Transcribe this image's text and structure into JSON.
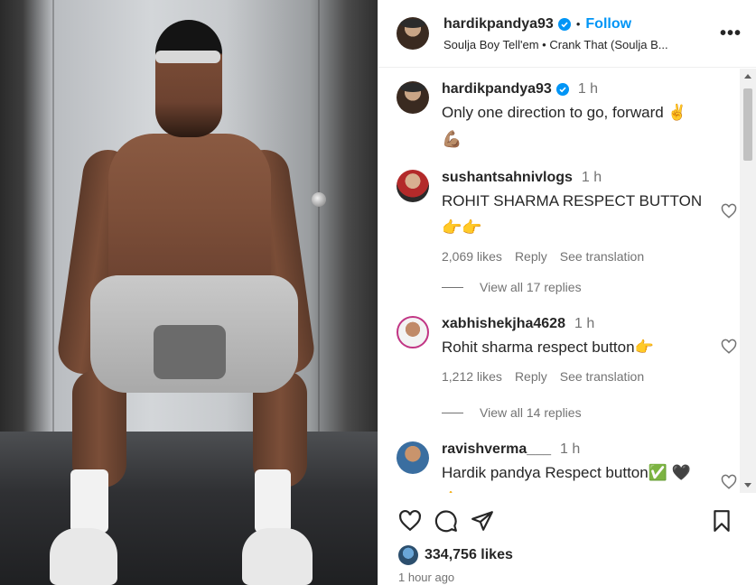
{
  "header": {
    "username": "hardikpandya93",
    "separator": "•",
    "follow_label": "Follow",
    "audio": "Soulja Boy Tell'em • Crank That (Soulja B...",
    "more_label": "•••"
  },
  "caption": {
    "username": "hardikpandya93",
    "time": "1 h",
    "text": "Only one direction to go, forward ✌️",
    "emoji_line": "💪🏽"
  },
  "comments": [
    {
      "username": "sushantsahnivlogs",
      "time": "1 h",
      "text": "ROHIT SHARMA RESPECT BUTTON",
      "emoji_line": "👉👉",
      "likes": "2,069 likes",
      "reply": "Reply",
      "translation": "See translation",
      "view_replies": "View all 17 replies"
    },
    {
      "username": "xabhishekjha4628",
      "time": "1 h",
      "text": "Rohit sharma respect button👉",
      "likes": "1,212 likes",
      "reply": "Reply",
      "translation": "See translation",
      "view_replies": "View all 14 replies"
    },
    {
      "username": "ravishverma___",
      "time": "1 h",
      "text": "Hardik pandya Respect button✅ 🖤",
      "emoji_line": "👉"
    }
  ],
  "footer": {
    "likes": "334,756 likes",
    "posted": "1 hour ago"
  },
  "icons": {
    "like": "heart-icon",
    "comment": "comment-icon",
    "share": "share-icon",
    "save": "bookmark-icon",
    "verified": "verified-badge-icon"
  },
  "colors": {
    "accent": "#0095f6",
    "text": "#262626",
    "muted": "#737373"
  }
}
